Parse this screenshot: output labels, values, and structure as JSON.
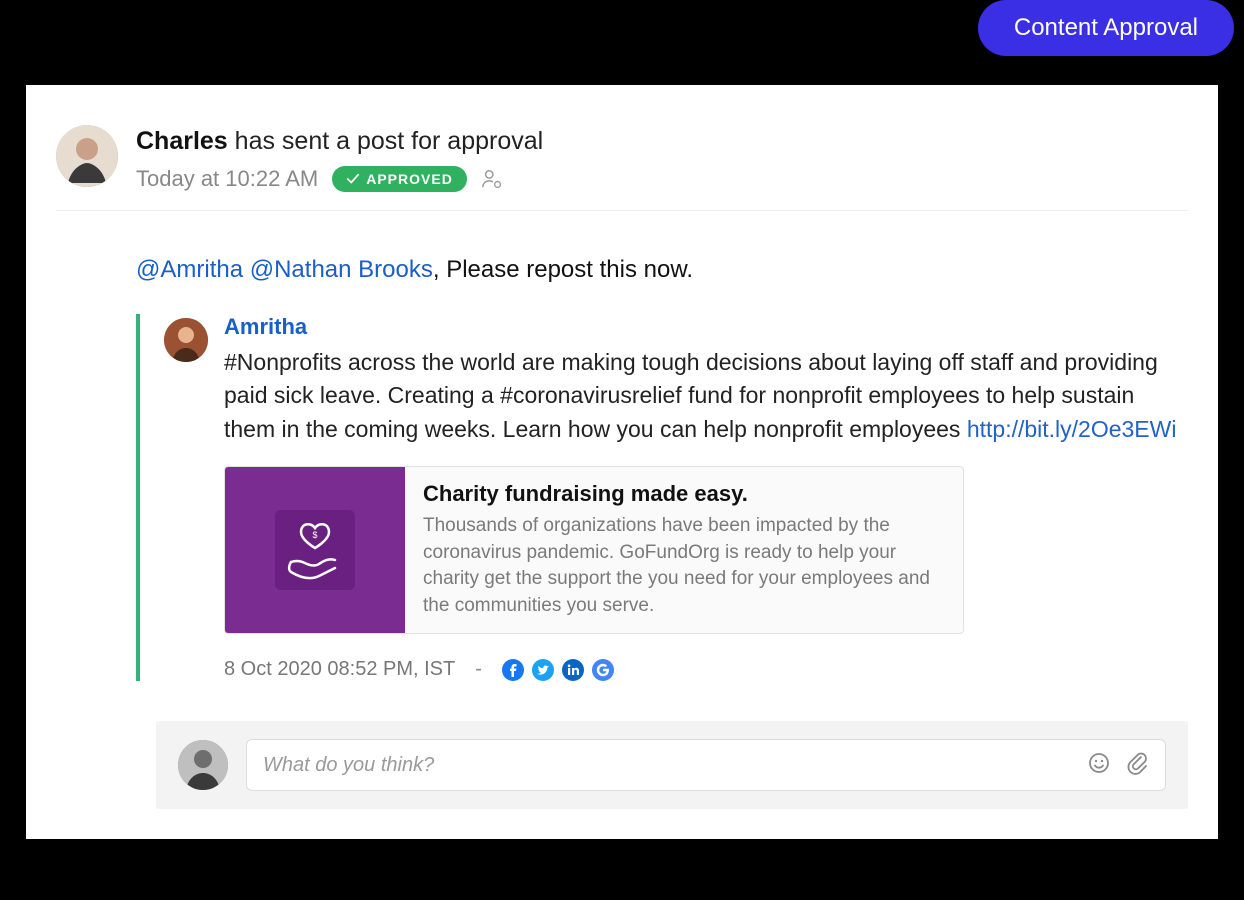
{
  "topBadge": {
    "label": "Content Approval"
  },
  "header": {
    "senderName": "Charles",
    "actionText": "has sent a post for approval",
    "timestamp": "Today at 10:22 AM",
    "status": "APPROVED"
  },
  "instruction": {
    "mention1": "@Amritha",
    "mention2": "@Nathan Brooks",
    "tail": ", Please repost this now."
  },
  "post": {
    "author": "Amritha",
    "text": "#Nonprofits across the world are making tough decisions about laying off staff and providing paid sick leave. Creating a #coronavirusrelief fund for nonprofit employees to help sustain them in the coming weeks. Learn how you can help nonprofit employees ",
    "link": "http://bit.ly/2Oe3EWi",
    "preview": {
      "title": "Charity fundraising made easy.",
      "description": "Thousands of organizations have been impacted by the coronavirus pandemic. GoFundOrg is ready to help your charity get the support the you need for your employees and the communities you serve."
    },
    "timestamp": "8 Oct 2020 08:52 PM, IST",
    "dash": "-"
  },
  "comment": {
    "placeholder": "What do you think?"
  },
  "icons": {
    "facebook": "facebook-icon",
    "twitter": "twitter-icon",
    "linkedin": "linkedin-icon",
    "google": "google-icon",
    "emoji": "emoji-icon",
    "attach": "attachment-icon",
    "userSettings": "user-settings-icon",
    "charity": "charity-hand-heart-icon"
  }
}
